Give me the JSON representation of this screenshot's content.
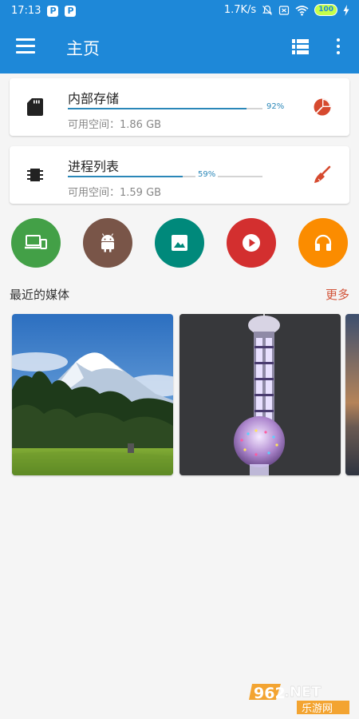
{
  "status_bar": {
    "time": "17:13",
    "app_icons": [
      "P",
      "P"
    ],
    "speed": "1.7K/s",
    "battery": "100"
  },
  "app_bar": {
    "title": "主页",
    "menu_icon": "hamburger-menu-icon",
    "list_icon": "list-view-icon",
    "more_icon": "more-vert-icon"
  },
  "storage_card": {
    "icon": "sd-card-icon",
    "title": "内部存储",
    "usage_percent_label": "92%",
    "usage_fraction": 0.92,
    "free_space": "可用空间：1.86 GB",
    "action_icon": "pie-chart-icon"
  },
  "process_card": {
    "icon": "memory-chip-icon",
    "title": "进程列表",
    "usage_percent_label": "59%",
    "usage_fraction": 0.59,
    "free_space": "可用空间：1.59 GB",
    "action_icon": "broom-clean-icon"
  },
  "quick_actions": [
    {
      "name": "devices-icon",
      "color": "#43a047"
    },
    {
      "name": "android-apps-icon",
      "color": "#795548"
    },
    {
      "name": "image-icon",
      "color": "#00897b"
    },
    {
      "name": "video-play-icon",
      "color": "#d32f2f"
    },
    {
      "name": "headphones-audio-icon",
      "color": "#fb8c00"
    }
  ],
  "recent_media": {
    "title": "最近的媒体",
    "more_label": "更多"
  },
  "watermark": {
    "text_top": "962.NET",
    "text_bottom": "乐游网"
  },
  "colors": {
    "primary": "#1e88d8",
    "accent": "#d2553a",
    "progress": "#2a87b8"
  }
}
